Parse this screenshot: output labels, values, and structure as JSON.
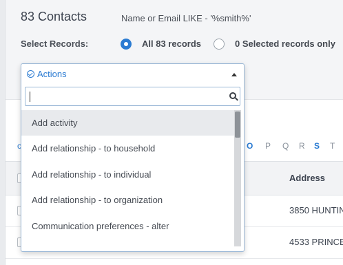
{
  "header": {
    "title": "83 Contacts",
    "filter": "Name or Email LIKE - '%smith%'"
  },
  "select_records": {
    "label": "Select Records:",
    "options": [
      {
        "label": "All 83 records",
        "selected": true
      },
      {
        "label": "0 Selected records only",
        "selected": false
      }
    ]
  },
  "alphabet": {
    "partial_left": "c",
    "visible": [
      "O",
      "P",
      "Q",
      "R",
      "S",
      "T"
    ],
    "active": [
      "O",
      "S"
    ]
  },
  "table": {
    "columns": {
      "address": "Address"
    },
    "rows": [
      {
        "address": "3850 HUNTIN"
      },
      {
        "address": "4533 PRINCE"
      }
    ]
  },
  "actions_dropdown": {
    "label": "Actions",
    "search_value": "",
    "items": [
      "Add activity",
      "Add relationship - to household",
      "Add relationship - to individual",
      "Add relationship - to organization",
      "Communication preferences - alter"
    ],
    "highlighted_index": 0
  },
  "colors": {
    "accent": "#2b7bd2",
    "highlight": "#e8eaed",
    "text": "#3d4450"
  }
}
